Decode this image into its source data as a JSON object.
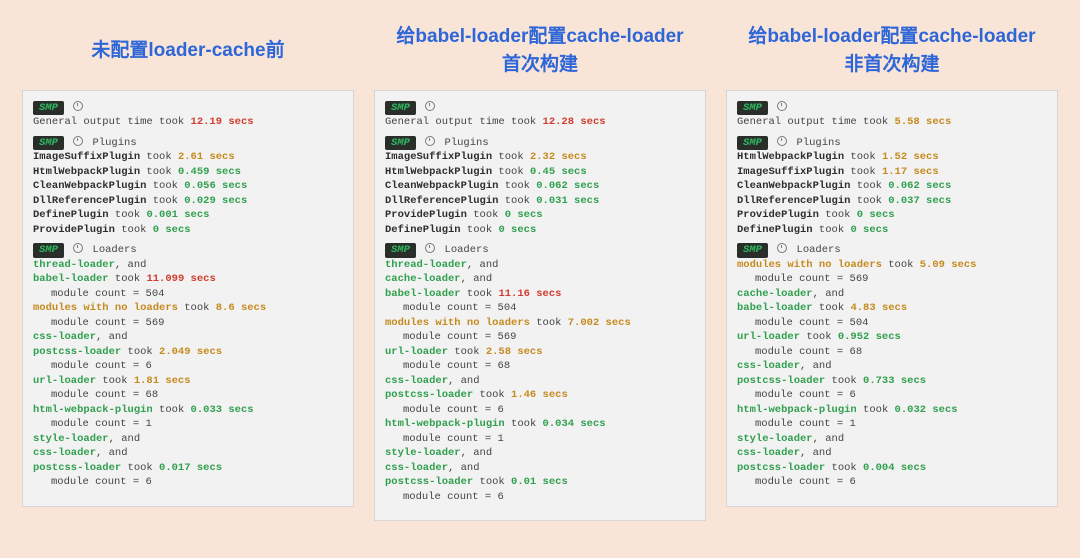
{
  "labels": {
    "smp": "SMP",
    "general_prefix": "General output time took ",
    "plugins": "Plugins",
    "loaders": "Loaders",
    "module_count": "module count = ",
    "and": ", and"
  },
  "cols": [
    {
      "heading": "未配置loader-cache前",
      "general_time": "12.19 secs",
      "general_color": "red",
      "plugins": [
        {
          "name": "ImageSuffixPlugin",
          "took": " took ",
          "time": "2.61 secs",
          "color": "orn"
        },
        {
          "name": "HtmlWebpackPlugin",
          "took": " took ",
          "time": "0.459 secs",
          "color": "grn"
        },
        {
          "name": "CleanWebpackPlugin",
          "took": " took ",
          "time": "0.056 secs",
          "color": "grn"
        },
        {
          "name": "DllReferencePlugin",
          "took": " took ",
          "time": "0.029 secs",
          "color": "grn"
        },
        {
          "name": "DefinePlugin",
          "took": " took ",
          "time": "0.001 secs",
          "color": "grn"
        },
        {
          "name": "ProvidePlugin",
          "took": " took ",
          "time": "0 secs",
          "color": "grn"
        }
      ],
      "loaders": [
        {
          "lines": [
            "thread-loader"
          ],
          "time": "11.099 secs",
          "color": "red",
          "took_by": "babel-loader",
          "module_count": "504"
        },
        {
          "lines": [
            "modules with no loaders"
          ],
          "time": "8.6 secs",
          "color": "orn",
          "module_count": "569",
          "name_color": "orn"
        },
        {
          "lines": [
            "css-loader"
          ],
          "time": "2.049 secs",
          "color": "orn",
          "took_by": "postcss-loader",
          "module_count": "6"
        },
        {
          "lines": [
            "url-loader"
          ],
          "time": "1.81 secs",
          "color": "orn",
          "module_count": "68",
          "took_inline": true
        },
        {
          "lines": [
            "html-webpack-plugin"
          ],
          "time": "0.033 secs",
          "color": "grn",
          "module_count": "1",
          "took_inline": true
        },
        {
          "lines": [
            "style-loader",
            "css-loader"
          ],
          "time": "0.017 secs",
          "color": "grn",
          "took_by": "postcss-loader",
          "module_count": "6"
        }
      ]
    },
    {
      "heading": "给babel-loader配置cache-loader\n首次构建",
      "general_time": "12.28 secs",
      "general_color": "red",
      "plugins": [
        {
          "name": "ImageSuffixPlugin",
          "took": " took ",
          "time": "2.32 secs",
          "color": "orn"
        },
        {
          "name": "HtmlWebpackPlugin",
          "took": " took ",
          "time": "0.45 secs",
          "color": "grn"
        },
        {
          "name": "CleanWebpackPlugin",
          "took": " took ",
          "time": "0.062 secs",
          "color": "grn"
        },
        {
          "name": "DllReferencePlugin",
          "took": " took ",
          "time": "0.031 secs",
          "color": "grn"
        },
        {
          "name": "ProvidePlugin",
          "took": " took ",
          "time": "0 secs",
          "color": "grn"
        },
        {
          "name": "DefinePlugin",
          "took": " took ",
          "time": "0 secs",
          "color": "grn"
        }
      ],
      "loaders": [
        {
          "lines": [
            "thread-loader",
            "cache-loader"
          ],
          "time": "11.16 secs",
          "color": "red",
          "took_by": "babel-loader",
          "module_count": "504"
        },
        {
          "lines": [
            "modules with no loaders"
          ],
          "time": "7.002 secs",
          "color": "orn",
          "module_count": "569",
          "name_color": "orn"
        },
        {
          "lines": [
            "url-loader"
          ],
          "time": "2.58 secs",
          "color": "orn",
          "module_count": "68",
          "took_inline": true
        },
        {
          "lines": [
            "css-loader"
          ],
          "time": "1.46 secs",
          "color": "orn",
          "took_by": "postcss-loader",
          "module_count": "6"
        },
        {
          "lines": [
            "html-webpack-plugin"
          ],
          "time": "0.034 secs",
          "color": "grn",
          "module_count": "1",
          "took_inline": true
        },
        {
          "lines": [
            "style-loader",
            "css-loader"
          ],
          "time": "0.01 secs",
          "color": "grn",
          "took_by": "postcss-loader",
          "module_count": "6"
        }
      ]
    },
    {
      "heading": "给babel-loader配置cache-loader\n非首次构建",
      "general_time": "5.58 secs",
      "general_color": "orn",
      "plugins": [
        {
          "name": "HtmlWebpackPlugin",
          "took": " took ",
          "time": "1.52 secs",
          "color": "orn"
        },
        {
          "name": "ImageSuffixPlugin",
          "took": " took ",
          "time": "1.17 secs",
          "color": "orn"
        },
        {
          "name": "CleanWebpackPlugin",
          "took": " took ",
          "time": "0.062 secs",
          "color": "grn"
        },
        {
          "name": "DllReferencePlugin",
          "took": " took ",
          "time": "0.037 secs",
          "color": "grn"
        },
        {
          "name": "ProvidePlugin",
          "took": " took ",
          "time": "0 secs",
          "color": "grn"
        },
        {
          "name": "DefinePlugin",
          "took": " took ",
          "time": "0 secs",
          "color": "grn"
        }
      ],
      "loaders": [
        {
          "lines": [
            "modules with no loaders"
          ],
          "time": "5.09 secs",
          "color": "orn",
          "module_count": "569",
          "name_color": "orn"
        },
        {
          "lines": [
            "cache-loader"
          ],
          "time": "4.83 secs",
          "color": "orn",
          "took_by": "babel-loader",
          "module_count": "504"
        },
        {
          "lines": [
            "url-loader"
          ],
          "time": "0.952 secs",
          "color": "grn",
          "module_count": "68",
          "took_inline": true
        },
        {
          "lines": [
            "css-loader"
          ],
          "time": "0.733 secs",
          "color": "grn",
          "took_by": "postcss-loader",
          "module_count": "6"
        },
        {
          "lines": [
            "html-webpack-plugin"
          ],
          "time": "0.032 secs",
          "color": "grn",
          "module_count": "1",
          "took_inline": true
        },
        {
          "lines": [
            "style-loader",
            "css-loader"
          ],
          "time": "0.004 secs",
          "color": "grn",
          "took_by": "postcss-loader",
          "module_count": "6"
        }
      ]
    }
  ]
}
